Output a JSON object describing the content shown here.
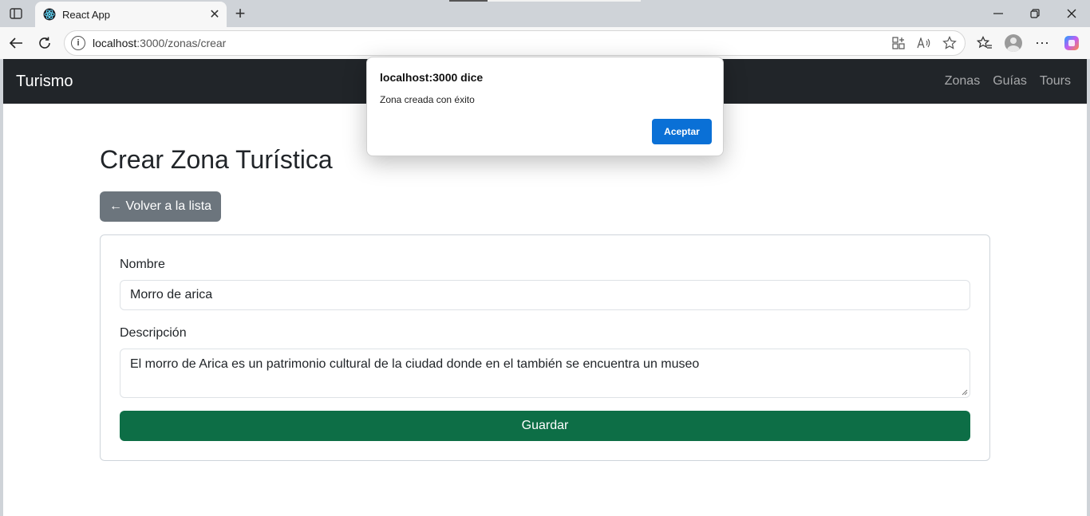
{
  "browser": {
    "tab_title": "React App",
    "url_host": "localhost",
    "url_path": ":3000/zonas/crear"
  },
  "navbar": {
    "brand": "Turismo",
    "links": [
      "Zonas",
      "Guías",
      "Tours"
    ]
  },
  "page": {
    "title": "Crear Zona Turística",
    "back_label": "← Volver a la lista",
    "form": {
      "name_label": "Nombre",
      "name_value": "Morro de arica",
      "description_label": "Descripción",
      "description_value": "El morro de Arica es un patrimonio cultural de la ciudad donde en el también se encuentra un museo",
      "save_label": "Guardar"
    }
  },
  "dialog": {
    "title": "localhost:3000 dice",
    "message": "Zona creada con éxito",
    "accept_label": "Aceptar"
  },
  "colors": {
    "navbar_bg": "#212529",
    "back_button": "#6c757d",
    "save_button": "#0d6e46",
    "dialog_button": "#0a70d6"
  }
}
